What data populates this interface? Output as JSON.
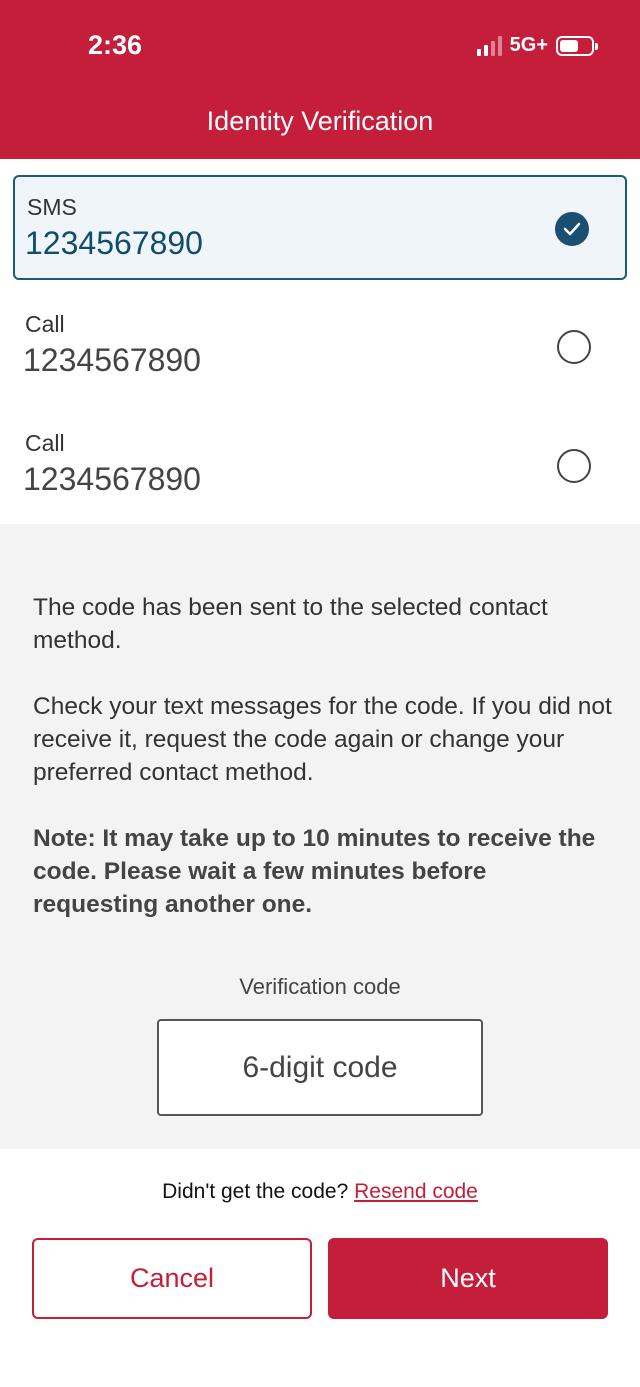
{
  "status_bar": {
    "time": "2:36",
    "network": "5G+",
    "signal_bars_filled": 2,
    "signal_bars_total": 4,
    "battery_level": 0.55
  },
  "header": {
    "title": "Identity Verification",
    "background_color": "#c41e3a"
  },
  "contact_options": [
    {
      "type": "SMS",
      "number": "1234567890",
      "selected": true
    },
    {
      "type": "Call",
      "number": "1234567890",
      "selected": false
    },
    {
      "type": "Call",
      "number": "1234567890",
      "selected": false
    }
  ],
  "info": {
    "sent_message": "The code has been sent to the selected contact method.",
    "check_message": "Check your text messages for the code. If you did not receive it, request the code again or change your preferred contact method.",
    "note": "Note: It may take up to 10 minutes to receive the code. Please wait a few minutes before requesting another one."
  },
  "verification": {
    "label": "Verification code",
    "placeholder": "6-digit code",
    "value": ""
  },
  "resend": {
    "prompt": "Didn't get the code?",
    "link_label": "Resend code"
  },
  "buttons": {
    "cancel_label": "Cancel",
    "next_label": "Next"
  },
  "icons": {
    "selected_radio": "check-circle-icon",
    "unselected_radio": "empty-circle-icon"
  }
}
